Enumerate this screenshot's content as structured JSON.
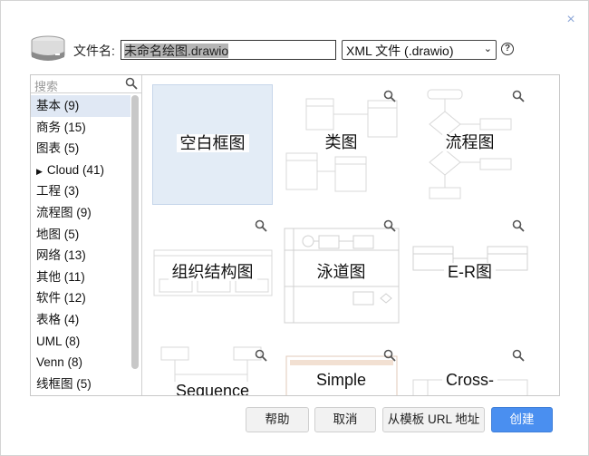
{
  "dialog": {
    "filename_label": "文件名:",
    "filename_value": "未命名绘图.drawio",
    "format_value": "XML 文件 (.drawio)",
    "help_icon": "?",
    "close_icon": "×"
  },
  "sidebar": {
    "search_placeholder": "搜索",
    "items": [
      {
        "label": "基本 (9)"
      },
      {
        "label": "商务 (15)"
      },
      {
        "label": "图表 (5)"
      },
      {
        "label": "Cloud (41)"
      },
      {
        "label": "工程 (3)"
      },
      {
        "label": "流程图 (9)"
      },
      {
        "label": "地图 (5)"
      },
      {
        "label": "网络 (13)"
      },
      {
        "label": "其他 (11)"
      },
      {
        "label": "软件 (12)"
      },
      {
        "label": "表格 (4)"
      },
      {
        "label": "UML (8)"
      },
      {
        "label": "Venn (8)"
      },
      {
        "label": "线框图 (5)"
      }
    ]
  },
  "templates": {
    "t1": "空白框图",
    "t2": "类图",
    "t3": "流程图",
    "t4": "组织结构图",
    "t5": "泳道图",
    "t6": "E-R图",
    "t7": "Sequence",
    "t8": "Simple",
    "t9": "Cross-"
  },
  "buttons": {
    "help": "帮助",
    "cancel": "取消",
    "from_url": "从模板 URL 地址",
    "create": "创建"
  },
  "colors": {
    "primary": "#4a8ff0",
    "selected_tile": "#e3ecf6",
    "active_item": "#e0e8f4"
  }
}
